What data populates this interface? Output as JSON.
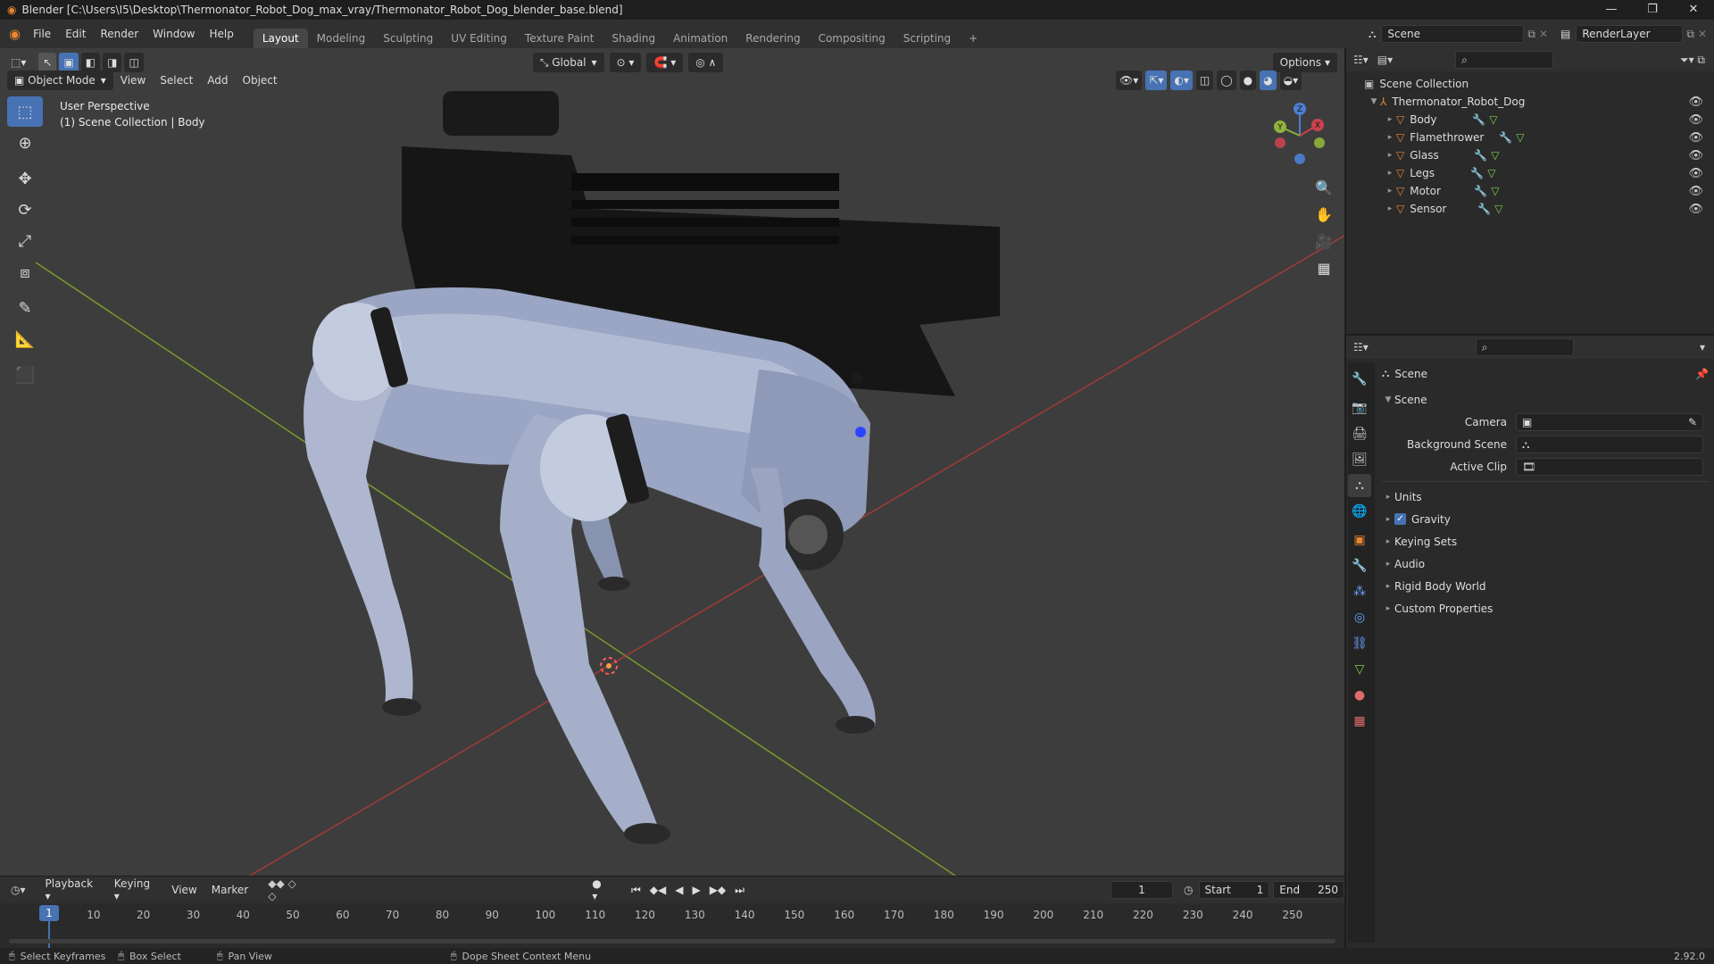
{
  "titlebar": {
    "app_icon": "blender-icon",
    "title": "Blender [C:\\Users\\I5\\Desktop\\Thermonator_Robot_Dog_max_vray/Thermonator_Robot_Dog_blender_base.blend]",
    "controls": [
      "—",
      "❐",
      "✕"
    ]
  },
  "menu": [
    "File",
    "Edit",
    "Render",
    "Window",
    "Help"
  ],
  "workspaces": [
    "Layout",
    "Modeling",
    "Sculpting",
    "UV Editing",
    "Texture Paint",
    "Shading",
    "Animation",
    "Rendering",
    "Compositing",
    "Scripting",
    "+"
  ],
  "active_workspace": "Layout",
  "scene_selector": "Scene",
  "renderlayer_selector": "RenderLayer",
  "viewport": {
    "mode": "Object Mode",
    "menus": [
      "View",
      "Select",
      "Add",
      "Object"
    ],
    "transform_orientation": "Global",
    "options_label": "Options",
    "overlay_line1": "User Perspective",
    "overlay_line2": "(1) Scene Collection | Body",
    "gizmo_axes": [
      "X",
      "Y",
      "Z"
    ]
  },
  "outliner": {
    "root": "Scene Collection",
    "collection": "Thermonator_Robot_Dog",
    "objects": [
      "Body",
      "Flamethrower",
      "Glass",
      "Legs",
      "Motor",
      "Sensor"
    ]
  },
  "properties": {
    "context": "Scene",
    "panel": "Scene",
    "fields": [
      {
        "label": "Camera",
        "value": ""
      },
      {
        "label": "Background Scene",
        "value": ""
      },
      {
        "label": "Active Clip",
        "value": ""
      }
    ],
    "subpanels": [
      "Units",
      "Gravity",
      "Keying Sets",
      "Audio",
      "Rigid Body World",
      "Custom Properties"
    ],
    "gravity_checked": true
  },
  "timeline": {
    "menus": [
      "Playback",
      "Keying",
      "View",
      "Marker"
    ],
    "current_frame": "1",
    "start_label": "Start",
    "start": "1",
    "end_label": "End",
    "end": "250",
    "ticks": [
      "1",
      "10",
      "20",
      "30",
      "40",
      "50",
      "60",
      "70",
      "80",
      "90",
      "100",
      "110",
      "120",
      "130",
      "140",
      "150",
      "160",
      "170",
      "180",
      "190",
      "200",
      "210",
      "220",
      "230",
      "240",
      "250"
    ]
  },
  "statusbar": {
    "items": [
      "Select Keyframes",
      "Box Select",
      "Pan View",
      "Dope Sheet Context Menu"
    ],
    "version": "2.92.0"
  }
}
